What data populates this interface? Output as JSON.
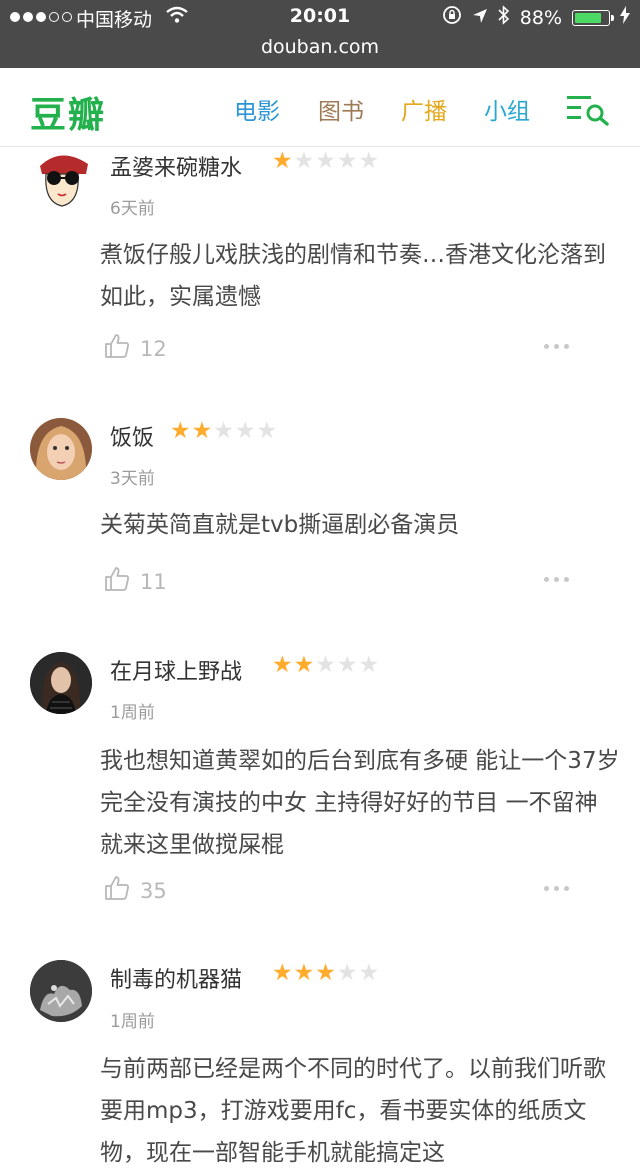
{
  "status_bar": {
    "carrier": "中国移动",
    "time": "20:01",
    "battery": "88%",
    "battery_level": 0.88,
    "url": "douban.com",
    "colors": {
      "background": "#4a4a4a",
      "battery": "#4cd964"
    }
  },
  "nav": {
    "logo": "豆瓣",
    "items": [
      {
        "label": "电影",
        "color": "#2e95d5"
      },
      {
        "label": "图书",
        "color": "#9e7a55"
      },
      {
        "label": "广播",
        "color": "#e3a81b"
      },
      {
        "label": "小组",
        "color": "#29a8d2"
      }
    ],
    "menu_icon": "menu-search-icon",
    "brand_color": "#22b14c"
  },
  "comments": [
    {
      "name": "孟婆来碗糖水",
      "rating": 1,
      "time": "6天前",
      "text": "煮饭仔般儿戏肤浅的剧情和节奏…香港文化沦落到如此，实属遗憾",
      "likes": "12"
    },
    {
      "name": "饭饭",
      "rating": 2,
      "time": "3天前",
      "text": "关菊英简直就是tvb撕逼剧必备演员",
      "likes": "11"
    },
    {
      "name": "在月球上野战",
      "rating": 2,
      "time": "1周前",
      "text": "我也想知道黄翠如的后台到底有多硬 能让一个37岁完全没有演技的中女 主持得好好的节目 一不留神就来这里做搅屎棍",
      "likes": "35"
    },
    {
      "name": "制毒的机器猫",
      "rating": 3,
      "time": "1周前",
      "text": "与前两部已经是两个不同的时代了。以前我们听歌要用mp3，打游戏要用fc，看书要实体的纸质文物，现在一部智能手机就能搞定这",
      "likes": ""
    }
  ],
  "colors": {
    "star_on": "#ffac2d",
    "star_off": "#e3e3e3"
  }
}
